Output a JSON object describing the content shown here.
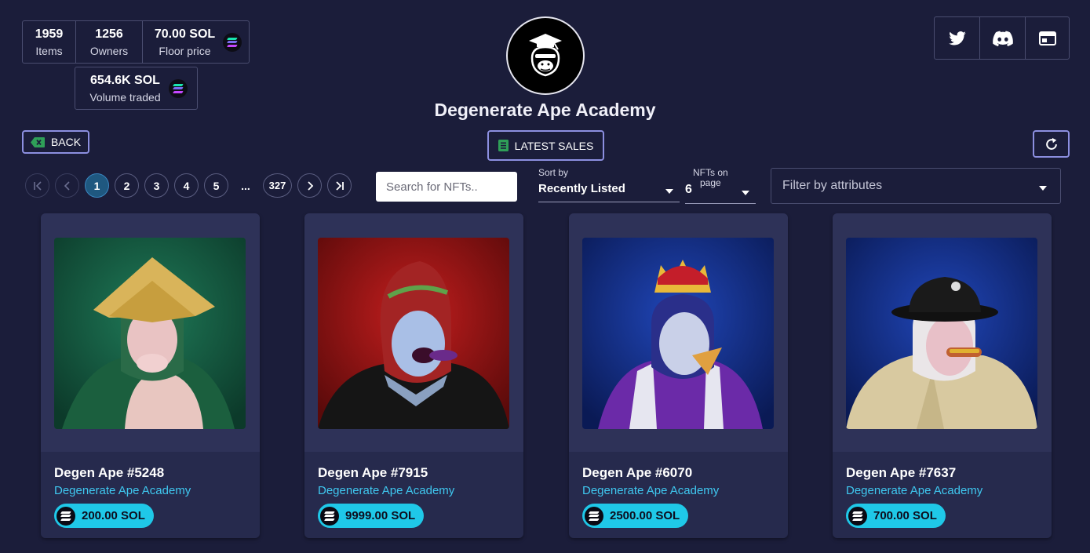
{
  "stats": {
    "items": {
      "value": "1959",
      "label": "Items"
    },
    "owners": {
      "value": "1256",
      "label": "Owners"
    },
    "floor": {
      "value": "70.00 SOL",
      "label": "Floor price"
    },
    "volume": {
      "value": "654.6K SOL",
      "label": "Volume traded"
    }
  },
  "collection": {
    "title": "Degenerate Ape Academy"
  },
  "social": [
    {
      "name": "twitter",
      "icon": "twitter-icon"
    },
    {
      "name": "discord",
      "icon": "discord-icon"
    },
    {
      "name": "website",
      "icon": "browser-window-icon"
    }
  ],
  "actions": {
    "back_label": "BACK",
    "latest_sales_label": "LATEST SALES"
  },
  "pagination": {
    "pages": [
      "1",
      "2",
      "3",
      "4",
      "5"
    ],
    "ellipsis": "...",
    "last_page": "327",
    "current_page": "1"
  },
  "search": {
    "placeholder": "Search for NFTs.."
  },
  "sort": {
    "caption": "Sort by",
    "value": "Recently Listed"
  },
  "per_page": {
    "caption_line1": "NFTs on",
    "caption_line2": "page",
    "value": "6"
  },
  "filter": {
    "placeholder": "Filter by attributes"
  },
  "cards": [
    {
      "name": "Degen Ape #5248",
      "collection": "Degenerate Ape Academy",
      "price": "200.00 SOL"
    },
    {
      "name": "Degen Ape #7915",
      "collection": "Degenerate Ape Academy",
      "price": "9999.00 SOL"
    },
    {
      "name": "Degen Ape #6070",
      "collection": "Degenerate Ape Academy",
      "price": "2500.00 SOL"
    },
    {
      "name": "Degen Ape #7637",
      "collection": "Degenerate Ape Academy",
      "price": "700.00 SOL"
    }
  ],
  "colors": {
    "background": "#1b1d3a",
    "card": "#262a4d",
    "accent_cyan": "#1fc8e8",
    "link_blue": "#3fc8f0",
    "button_border": "#8c8fe0",
    "active_page": "#1f5880"
  }
}
